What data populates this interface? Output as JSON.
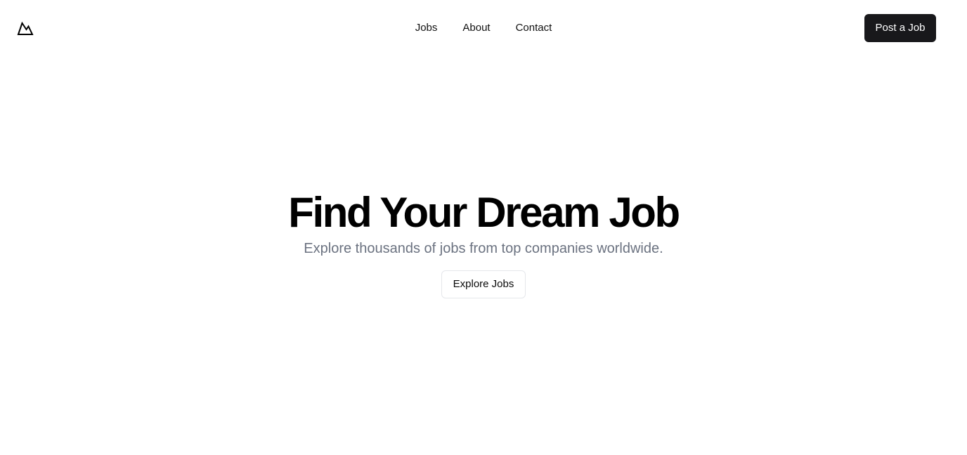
{
  "header": {
    "logo_icon": "mountain-icon",
    "nav": {
      "jobs_label": "Jobs",
      "about_label": "About",
      "contact_label": "Contact"
    },
    "post_job_label": "Post a Job"
  },
  "hero": {
    "title": "Find Your Dream Job",
    "subtitle": "Explore thousands of jobs from top companies worldwide.",
    "explore_label": "Explore Jobs"
  },
  "colors": {
    "primary_button_bg": "#18181b",
    "primary_button_text": "#ffffff",
    "subtitle_text": "#6b7280",
    "outline_button_border": "#e5e7eb"
  }
}
